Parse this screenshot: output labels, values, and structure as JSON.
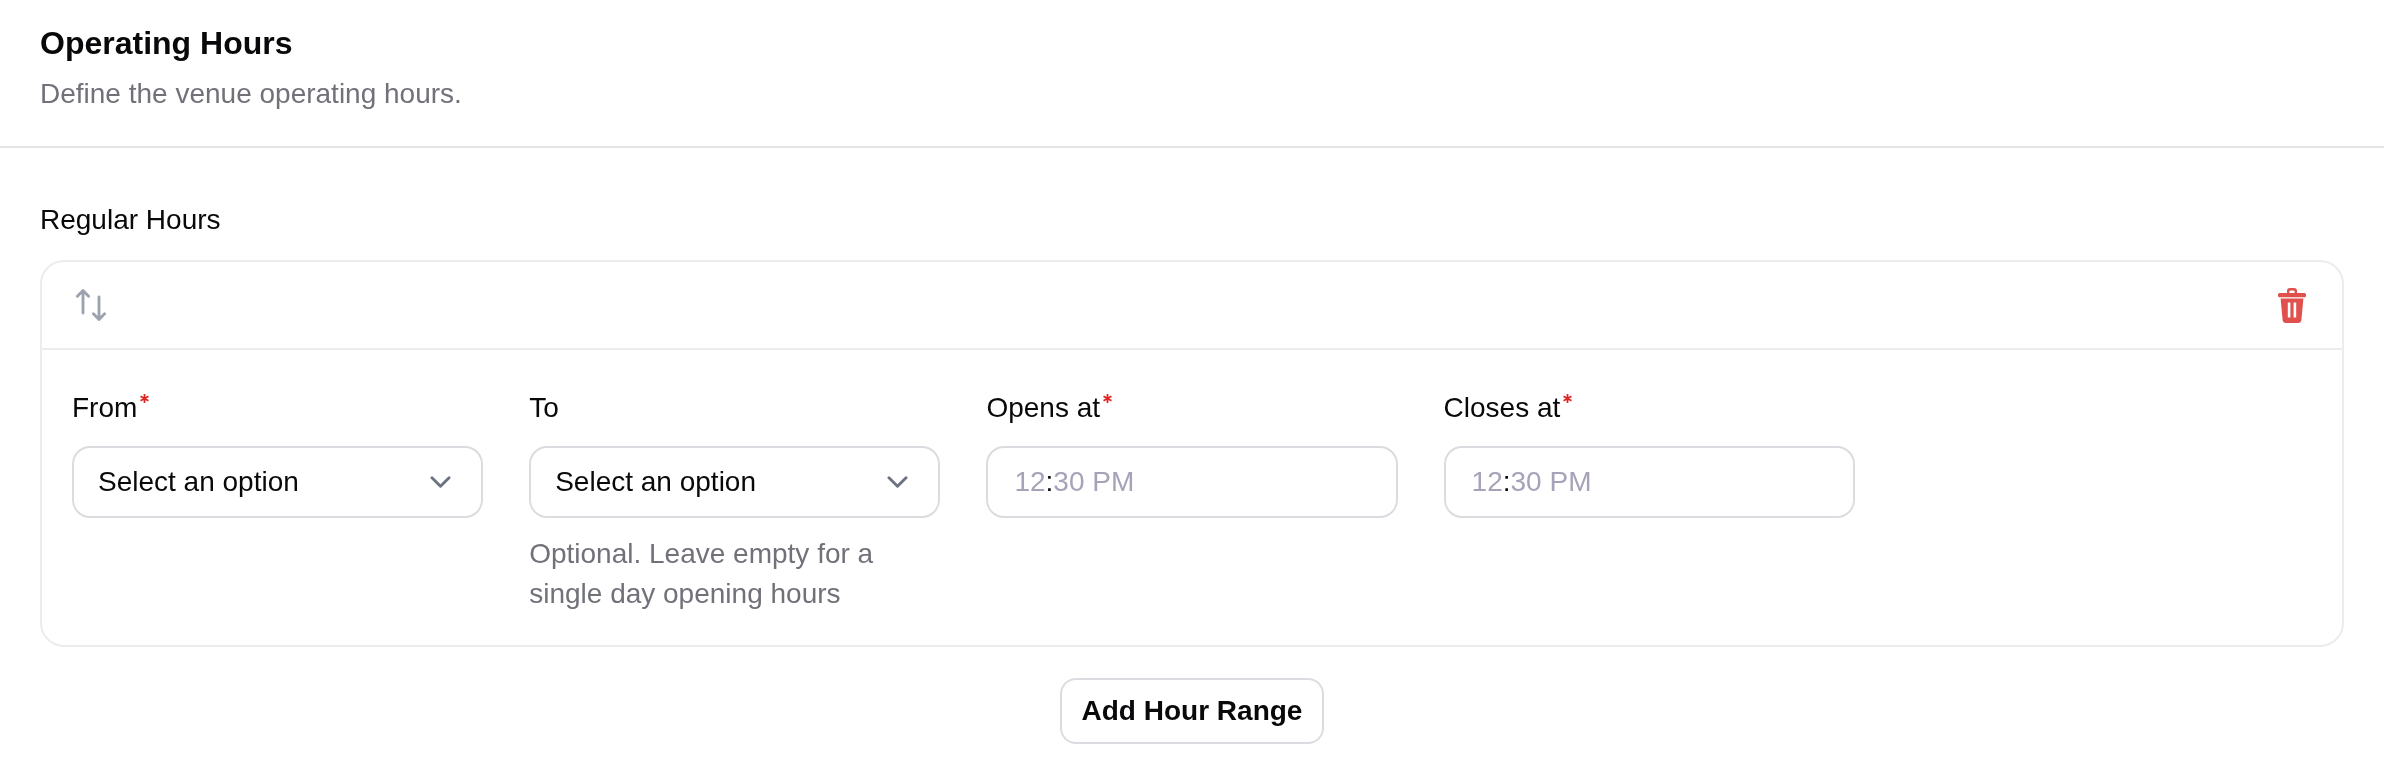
{
  "section": {
    "title": "Operating Hours",
    "description": "Define the venue operating hours."
  },
  "regular_hours": {
    "label": "Regular Hours",
    "ranges": [
      {
        "fields": [
          {
            "kind": "select",
            "label": "From",
            "required": true,
            "value": "Select an option"
          },
          {
            "kind": "select",
            "label": "To",
            "required": false,
            "value": "Select an option",
            "hint": "Optional. Leave empty for a single day opening hours"
          },
          {
            "kind": "time",
            "label": "Opens at",
            "required": true,
            "hour": "12",
            "separator": ":",
            "minute": "30",
            "period": "PM"
          },
          {
            "kind": "time",
            "label": "Closes at",
            "required": true,
            "hour": "12",
            "separator": ":",
            "minute": "30",
            "period": "PM"
          }
        ]
      }
    ],
    "add_button": "Add Hour Range"
  }
}
